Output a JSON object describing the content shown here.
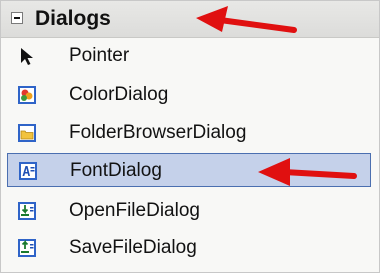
{
  "toolbox": {
    "category": {
      "title": "Dialogs",
      "state": "expanded"
    },
    "items": [
      {
        "label": "Pointer",
        "icon": "pointer-icon"
      },
      {
        "label": "ColorDialog",
        "icon": "color-dialog-icon"
      },
      {
        "label": "FolderBrowserDialog",
        "icon": "folder-browser-icon"
      },
      {
        "label": "FontDialog",
        "icon": "font-dialog-icon",
        "selected": true
      },
      {
        "label": "OpenFileDialog",
        "icon": "open-file-icon"
      },
      {
        "label": "SaveFileDialog",
        "icon": "save-file-icon"
      }
    ]
  },
  "colors": {
    "selection_bg": "#c5d1ea",
    "selection_border": "#4b6fb0",
    "annotation_arrow": "#e01010"
  }
}
